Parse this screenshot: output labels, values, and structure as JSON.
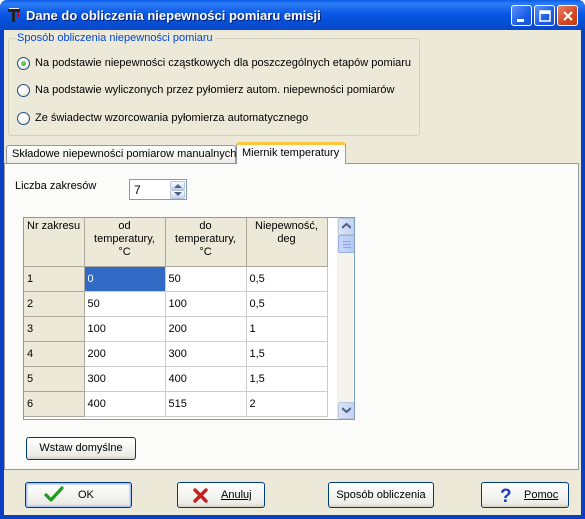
{
  "window": {
    "title": "Dane do obliczenia niepewności pomiaru emisji"
  },
  "method_group": {
    "legend": "Sposób obliczenia niepewności pomiaru",
    "options": [
      {
        "label": "Na podstawie niepewności cząstkowych dla poszczególnych etapów pomiaru",
        "selected": true
      },
      {
        "label": "Na podstawie wyliczonych przez pyłomierz autom. niepewności pomiarów",
        "selected": false
      },
      {
        "label": "Ze świadectw wzorcowania pyłomierza automatycznego",
        "selected": false
      }
    ]
  },
  "tabs": [
    {
      "label": "Składowe niepewności  pomiarow manualnych",
      "active": false
    },
    {
      "label": "Miernik temperatury",
      "active": true
    }
  ],
  "ranges": {
    "count_label": "Liczba zakresów",
    "count_value": "7"
  },
  "grid": {
    "headers": [
      "Nr zakresu",
      "od temperatury, °C",
      "do temperatury, °C",
      "Niepewność, deg"
    ],
    "rows": [
      [
        "1",
        "0",
        "50",
        "0,5"
      ],
      [
        "2",
        "50",
        "100",
        "0,5"
      ],
      [
        "3",
        "100",
        "200",
        "1"
      ],
      [
        "4",
        "200",
        "300",
        "1,5"
      ],
      [
        "5",
        "300",
        "400",
        "1,5"
      ],
      [
        "6",
        "400",
        "515",
        "2"
      ]
    ]
  },
  "buttons": {
    "insert_defaults": "Wstaw domyślne",
    "ok": "OK",
    "cancel": "Anuluj",
    "method": "Sposób obliczenia",
    "help": "Pomoc"
  },
  "colors": {
    "titlebar": "#0a58e4",
    "selection": "#316ac5",
    "group_legend": "#0046d5",
    "active_tab_highlight": "#ffc83c"
  }
}
